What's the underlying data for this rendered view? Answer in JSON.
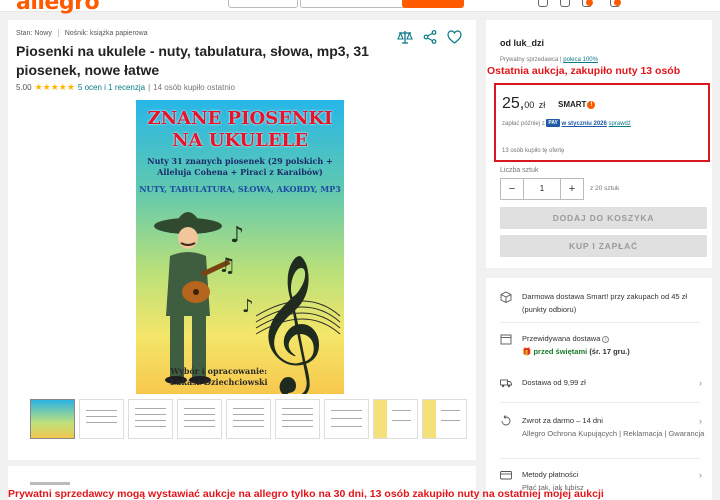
{
  "header": {
    "logo": "allegro",
    "icons": [
      "search-box",
      "category-select",
      "search-button",
      "notifications-icon",
      "favorites-icon",
      "cart-icon"
    ]
  },
  "product": {
    "meta": {
      "condition_label": "Stan:",
      "condition_value": "Nowy",
      "carrier_label": "Nośnik:",
      "carrier_value": "książka papierowa"
    },
    "title": "Piosenki na ukulele - nuty, tabulatura, słowa, mp3, 31 piosenek, nowe łatwe",
    "rating_value": "5.00",
    "rating_stars": 5,
    "rating_counts": "5 ocen i 1 recenzja",
    "bought_info": "14 osób kupiło ostatnio",
    "cover": {
      "title": "ZNANE PIOSENKI NA UKULELE",
      "subtitle": "Nuty 31 znanych piosenek (29 polskich + Alleluja Cohena + Piraci z Karaibów)",
      "tags": "NUTY, TABULATURA, SŁOWA, AKORDY, MP3",
      "credit_label": "Wybór i opracowanie:",
      "credit_name": "Łukasz Dziechciowski"
    },
    "thumbnail_count": 9
  },
  "buy_box": {
    "seller": "od luk_dzi",
    "seller_type": "Prywatny sprzedawca",
    "seller_rating": "poleca 100%",
    "annotation": "Ostatnia aukcja, zakupiło nuty 13 osób",
    "price_main": "25,",
    "price_cents": "00",
    "currency": "zł",
    "smart_label": "SMART",
    "pay_later_prefix": "zapłać później z",
    "pay_badge": "PAY",
    "pay_later_month": "w styczniu 2026",
    "pay_later_link": "sprawdź",
    "bought_offer": "13 osób kupiło tę ofertę",
    "quantity_label": "Liczba sztuk",
    "quantity_value": "1",
    "quantity_of": "z 20 sztuk",
    "add_to_cart": "DODAJ DO KOSZYKA",
    "buy_now": "KUP I ZAPŁAĆ"
  },
  "delivery": {
    "free_delivery": "Darmowa dostawa Smart! przy zakupach od 45 zł (punkty odbioru)",
    "expected_label": "Przewidywana dostawa",
    "expected_value": "przed świętami",
    "expected_date": "(śr. 17 gru.)",
    "delivery_cost": "Dostawa od 9,99 zł",
    "returns": "Zwrot za darmo – 14 dni",
    "protection": "Allegro Ochrona Kupujących | Reklamacja | Gwarancja",
    "payment_methods": "Metody płatności",
    "payment_sub": "Płać tak, jak lubisz"
  },
  "footer_banner": "Prywatni sprzedawcy mogą wystawiać aukcje na allegro tylko na 30 dni, 13 osób zakupiło nuty na ostatniej mojej aukcji",
  "colors": {
    "brand": "#ff5a00",
    "annotation_red": "#e3151a",
    "link_teal": "#0a7a86"
  }
}
